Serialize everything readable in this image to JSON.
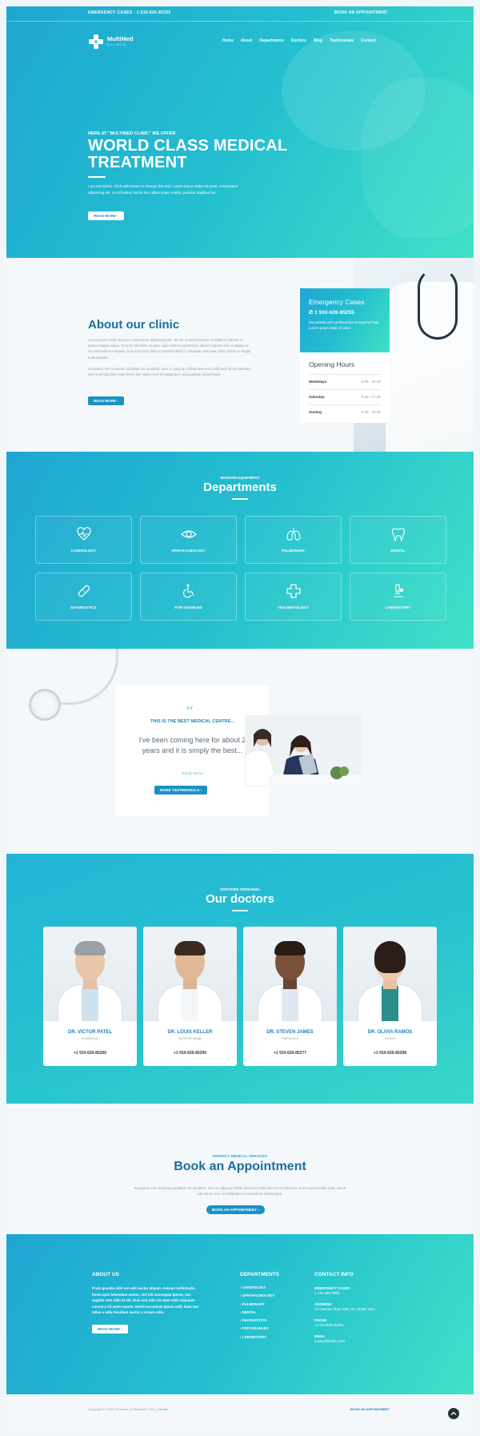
{
  "topbar": {
    "emergency": "EMERGENCY CASES · 1-910-626-85255",
    "appointment": "BOOK AN APPOINTMENT"
  },
  "logo": {
    "name": "MultiMed",
    "sub": "CLINIC"
  },
  "nav": [
    "Home",
    "About",
    "Departments",
    "Doctors",
    "Blog",
    "Testimonials",
    "Contact"
  ],
  "hero": {
    "kicker": "HERE AT \"MULTIMED CLINIC\" WE OFFER",
    "title": "WORLD CLASS MEDICAL TREATMENT",
    "text": "I am text block. Click edit button to change this text. Lorem ipsum dolor sit amet, consectetur adipiscing elit. Ut elit tellus, luctus nec ullamcorper mattis, pulvinar dapibus leo.",
    "button": "READ MORE ›"
  },
  "about": {
    "title": "About our clinic",
    "p1": "Lorem ipsum dolor sit amet, consectetur adipisicing elit, sed do eiusmod tempor incididunt ut labore et dolore magna aliqua. Ut enim ad minim veniam, quis nostrud exercitation ullamco laboris nisi ut aliquip ex ea commodo consequat. Duis aute irure dolor in reprehenderit in voluptate velit esse cillum dolore eu fugiat nulla pariatur.",
    "p2": "Excepteur sint occaecat cupidatat non proident, sunt in culpa qui officia deserunt mollit anim id est laborum. Sed ut perspiciatis unde omnis iste natus error sit voluptatem accusantium doloremque.",
    "button": "READ MORE ›"
  },
  "emergency": {
    "title": "Emergency Cases",
    "phone": "1 910-626-85255",
    "text": "We provide 24/7 professional emergency help. Lorem ipsum dolor sit amet."
  },
  "hours": {
    "title": "Opening Hours",
    "rows": [
      {
        "day": "Weekdays",
        "time": "9.00 - 20.00"
      },
      {
        "day": "Saturday",
        "time": "9.30 - 17.30"
      },
      {
        "day": "Sunday",
        "time": "9.30 - 15.00"
      }
    ]
  },
  "departments": {
    "kicker": "MODERN EQUIPMENT",
    "title": "Departments",
    "items": [
      {
        "label": "CARDIOLOGY",
        "icon": "heart-pulse-icon"
      },
      {
        "label": "OPHTHALMOLOGY",
        "icon": "eye-icon"
      },
      {
        "label": "PULMONARY",
        "icon": "lungs-icon"
      },
      {
        "label": "DENTAL",
        "icon": "tooth-icon"
      },
      {
        "label": "DIAGNOSTICS",
        "icon": "bandage-icon"
      },
      {
        "label": "FOR DISABLED",
        "icon": "wheelchair-icon"
      },
      {
        "label": "TRAUMATOLOGY",
        "icon": "cross-icon"
      },
      {
        "label": "LABORATORY",
        "icon": "microscope-icon"
      }
    ]
  },
  "testimonial": {
    "head": "THIS IS THE BEST MEDICAL CENTRE...",
    "quote": "I've been coming here for about 2 years and it is simply the best...",
    "author": "Randy Burne",
    "button": "MORE TESTIMONIALS ›"
  },
  "doctors": {
    "kicker": "CERTIFIED PERSONEL",
    "title": "Our doctors",
    "items": [
      {
        "name": "DR. VICTOR PATEL",
        "spec": "Cardiology",
        "phone": "+1 910-626-85266"
      },
      {
        "name": "DR. LOUIS KELLER",
        "spec": "Ophthalmology",
        "phone": "+1 910-626-85290"
      },
      {
        "name": "DR. STEVEN JAMES",
        "spec": "Pulmonary",
        "phone": "+1 910-626-85277"
      },
      {
        "name": "DR. OLIVIA RAMOS",
        "spec": "Dental",
        "phone": "+1 910-626-85288"
      }
    ]
  },
  "book": {
    "kicker": "PERFECT MEDICAL SERVICES",
    "title": "Book an Appointment",
    "text": "Excepteur sint occaecat cupidatat non proident, sunt in culpa qui officia deserunt mollit anim id est laborum. Sed ut perspiciatis unde omnis iste natus error sit voluptatem accusantium doloremque.",
    "button": "BOOK AN APPOINTMENT ›"
  },
  "footer": {
    "about_title": "ABOUT US",
    "about_text": "Proin gravida nibh vel velit auctor aliquet. Aenean sollicitudin, lorem quis bibendum auctor, nisi elit consequat ipsum, nec sagittis sem nibh id elit. Duis sed odio sit amet nibh vulputate cursus a sit amet mauris. Morbi accumsan ipsum velit. Nam nec tellus a odio tincidunt auctor a ornare odio.",
    "about_button": "READ MORE ›",
    "dept_title": "DEPARTMENTS",
    "dept_items": [
      "› CARDIOLOGY",
      "› OPHTHALMOLOGY",
      "› PULMONARY",
      "› DENTAL",
      "› DIAGNOSTICS",
      "› FOR DISABLED",
      "› LABORATORY"
    ],
    "contact_title": "CONTACT INFO",
    "contacts": [
      {
        "k": "EMERGENCY CASES",
        "v": "1 123-456-7890"
      },
      {
        "k": "ADDRESS",
        "v": "1st Avenue, New York, NY 10180, USA"
      },
      {
        "k": "PHONE",
        "v": "+1 910-626-85266"
      },
      {
        "k": "EMAIL",
        "v": "contact@clinic.com"
      }
    ]
  },
  "bottom": {
    "copy": "Copyright © 2016 | Powered by MultiMed Clinic |",
    "credits": "Credits",
    "book": "BOOK AN APPOINTMENT"
  },
  "colors": {
    "accent": "#1b92c2",
    "title": "#1b6f9e",
    "gradient_start": "#1fa6d2",
    "gradient_end": "#3fe1c6"
  }
}
